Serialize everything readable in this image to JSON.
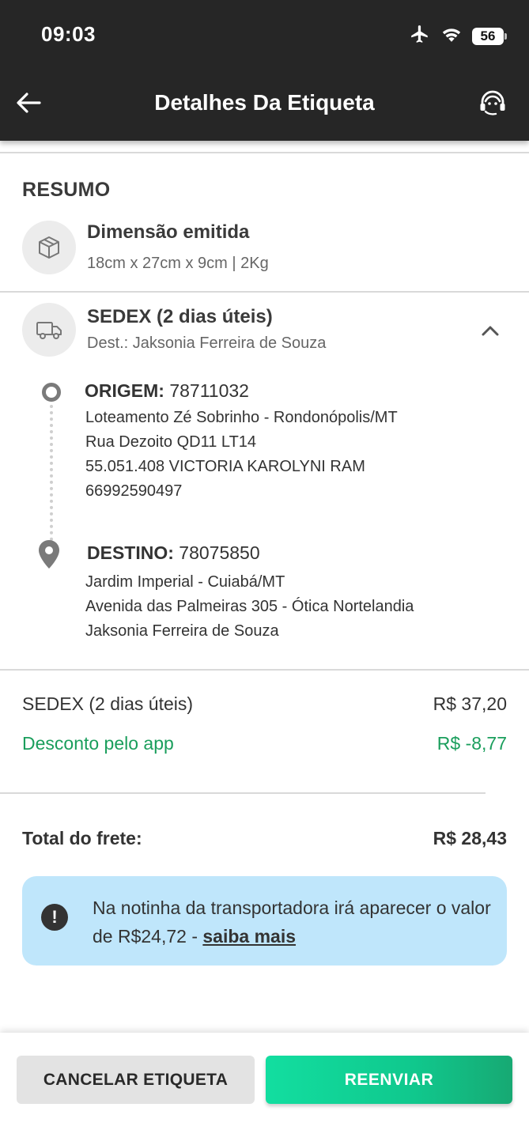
{
  "status_bar": {
    "time": "09:03",
    "battery": "56"
  },
  "header": {
    "title": "Detalhes Da Etiqueta"
  },
  "summary": {
    "title": "RESUMO",
    "dimension_label": "Dimensão emitida",
    "dimension_value": "18cm x 27cm x 9cm | 2Kg"
  },
  "shipping": {
    "service": "SEDEX (2 dias úteis)",
    "recipient": "Dest.: Jaksonia Ferreira de Souza"
  },
  "origin": {
    "label": "ORIGEM:",
    "cep": "78711032",
    "lines": [
      "Loteamento Zé Sobrinho - Rondonópolis/MT",
      "Rua Dezoito QD11 LT14",
      "55.051.408 VICTORIA KAROLYNI RAM",
      "66992590497"
    ]
  },
  "destination": {
    "label": "DESTINO:",
    "cep": "78075850",
    "lines": [
      "Jardim Imperial - Cuiabá/MT",
      "Avenida das Palmeiras 305 - Ótica Nortelandia",
      "Jaksonia Ferreira de Souza"
    ]
  },
  "prices": {
    "service_label": "SEDEX (2 dias úteis)",
    "service_value": "R$ 37,20",
    "discount_label": "Desconto pelo app",
    "discount_value": "R$ -8,77",
    "total_label": "Total do frete:",
    "total_value": "R$ 28,43"
  },
  "info": {
    "text": "Na notinha da transportadora irá aparecer o valor de R$24,72 - ",
    "link": "saiba mais"
  },
  "actions": {
    "cancel": "CANCELAR ETIQUETA",
    "resend": "REENVIAR"
  },
  "colors": {
    "header_bg": "#262626",
    "accent_green": "#1a9e5c",
    "button_green": "#10c88d",
    "info_bg": "#bfe6fb"
  }
}
